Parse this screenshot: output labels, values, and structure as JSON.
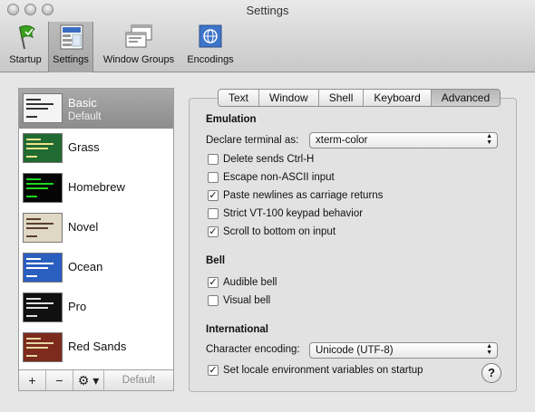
{
  "window": {
    "title": "Settings"
  },
  "toolbar": {
    "items": [
      {
        "label": "Startup",
        "icon": "flag-icon"
      },
      {
        "label": "Settings",
        "icon": "settings-icon",
        "selected": true
      },
      {
        "label": "Window Groups",
        "icon": "window-groups-icon"
      },
      {
        "label": "Encodings",
        "icon": "encodings-globe-icon"
      }
    ]
  },
  "profiles": {
    "items": [
      {
        "name": "Basic",
        "sub": "Default",
        "selected": true,
        "colors": {
          "bg": "#f4f4f4",
          "fg": "#333333"
        }
      },
      {
        "name": "Grass",
        "colors": {
          "bg": "#1f6b32",
          "fg": "#f1e38a"
        }
      },
      {
        "name": "Homebrew",
        "colors": {
          "bg": "#050505",
          "fg": "#1fd61f"
        }
      },
      {
        "name": "Novel",
        "colors": {
          "bg": "#dfd8c4",
          "fg": "#5a3f2b"
        }
      },
      {
        "name": "Ocean",
        "colors": {
          "bg": "#2b5fbf",
          "fg": "#ffffff"
        }
      },
      {
        "name": "Pro",
        "colors": {
          "bg": "#101010",
          "fg": "#e0e0e0"
        }
      },
      {
        "name": "Red Sands",
        "colors": {
          "bg": "#7c2b1d",
          "fg": "#e9d6a6"
        }
      }
    ],
    "footer": {
      "add": "+",
      "remove": "−",
      "gear": "⚙ ▾",
      "default_label": "Default"
    }
  },
  "tabs": [
    {
      "label": "Text"
    },
    {
      "label": "Window"
    },
    {
      "label": "Shell"
    },
    {
      "label": "Keyboard"
    },
    {
      "label": "Advanced",
      "active": true
    }
  ],
  "emulation": {
    "title": "Emulation",
    "declare_label": "Declare terminal as:",
    "declare_value": "xterm-color",
    "options": [
      {
        "label": "Delete sends Ctrl-H",
        "checked": false
      },
      {
        "label": "Escape non-ASCII input",
        "checked": false
      },
      {
        "label": "Paste newlines as carriage returns",
        "checked": true
      },
      {
        "label": "Strict VT-100 keypad behavior",
        "checked": false
      },
      {
        "label": "Scroll to bottom on input",
        "checked": true
      }
    ]
  },
  "bell": {
    "title": "Bell",
    "options": [
      {
        "label": "Audible bell",
        "checked": true
      },
      {
        "label": "Visual bell",
        "checked": false
      }
    ]
  },
  "international": {
    "title": "International",
    "encoding_label": "Character encoding:",
    "encoding_value": "Unicode (UTF-8)",
    "locale_label": "Set locale environment variables on startup",
    "locale_checked": true
  },
  "help": {
    "label": "?"
  }
}
